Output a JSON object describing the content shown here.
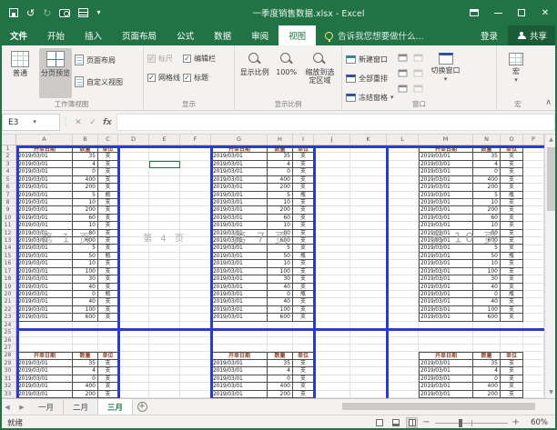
{
  "window": {
    "title": "一季度销售数据.xlsx - Excel",
    "qat_icons": [
      "save",
      "undo",
      "redo",
      "camera",
      "table",
      "more"
    ]
  },
  "menubar": {
    "file": "文件",
    "tabs": [
      "开始",
      "插入",
      "页面布局",
      "公式",
      "数据",
      "审阅",
      "视图"
    ],
    "active_tab": "视图",
    "tell_me": "告诉我您想要做什么...",
    "sign_in": "登录",
    "share": "共享"
  },
  "ribbon": {
    "workbook_views": {
      "label": "工作簿视图",
      "normal": "普通",
      "page_break_preview": "分页预览",
      "page_layout": "页面布局",
      "custom_views": "自定义视图"
    },
    "show": {
      "label": "显示",
      "ruler": "标尺",
      "formula_bar": "编辑栏",
      "gridlines": "网格线",
      "headings": "标题",
      "ruler_checked": true,
      "formula_bar_checked": true,
      "gridlines_checked": true,
      "headings_checked": true
    },
    "zoom": {
      "label": "显示比例",
      "zoom": "显示比例",
      "hundred": "100%",
      "to_selection": "缩放到选定区域"
    },
    "window": {
      "label": "窗口",
      "new_window": "新建窗口",
      "arrange_all": "全部重排",
      "freeze_panes": "冻结窗格",
      "switch_windows": "切换窗口"
    },
    "macros": {
      "label": "宏",
      "macros": "宏"
    }
  },
  "formula_bar": {
    "name_box": "E3"
  },
  "grid": {
    "column_letters": [
      "A",
      "B",
      "C",
      "D",
      "E",
      "F",
      "G",
      "H",
      "I",
      "J",
      "K",
      "L",
      "M",
      "N",
      "O",
      "P"
    ],
    "row_count": 33,
    "selected_cell": "E3",
    "table": {
      "headers": [
        "开单日期",
        "数量",
        "单位"
      ],
      "rows": [
        [
          "2019/03/01",
          "35",
          "支"
        ],
        [
          "2019/03/01",
          "4",
          "支"
        ],
        [
          "2019/03/01",
          "0",
          "支"
        ],
        [
          "2019/03/01",
          "400",
          "支"
        ],
        [
          "2019/03/01",
          "200",
          "支"
        ],
        [
          "2019/03/01",
          "5",
          "瓶"
        ],
        [
          "2019/03/01",
          "10",
          "支"
        ],
        [
          "2019/03/01",
          "200",
          "支"
        ],
        [
          "2019/03/01",
          "60",
          "支"
        ],
        [
          "2019/03/01",
          "10",
          "支"
        ],
        [
          "2019/03/01",
          "80",
          "支"
        ],
        [
          "2019/03/01",
          "600",
          "支"
        ],
        [
          "2019/03/01",
          "5",
          "支"
        ],
        [
          "2019/03/01",
          "50",
          "瓶"
        ],
        [
          "2019/03/01",
          "10",
          "支"
        ],
        [
          "2019/03/01",
          "100",
          "支"
        ],
        [
          "2019/03/01",
          "30",
          "支"
        ],
        [
          "2019/03/01",
          "40",
          "支"
        ],
        [
          "2019/03/01",
          "0",
          "瓶"
        ],
        [
          "2019/03/01",
          "40",
          "支"
        ],
        [
          "2019/03/01",
          "100",
          "支"
        ],
        [
          "2019/03/01",
          "600",
          "支"
        ]
      ]
    },
    "watermarks": [
      "第 1 页",
      "第 4 页",
      "第 7 页",
      "第 10 页"
    ]
  },
  "sheet_tabs": {
    "tabs": [
      "一月",
      "二月",
      "三月"
    ],
    "active": "三月"
  },
  "status_bar": {
    "ready": "就绪",
    "zoom_level": "60%"
  },
  "icons": {
    "dropdown": "▾",
    "undo": "↺",
    "redo": "↻",
    "close": "✕",
    "check": "✓",
    "left": "◀",
    "right": "▶",
    "up": "▲",
    "down": "▼",
    "plus": "+",
    "collapse": "∧",
    "sep": "⋮",
    "cancel": "✕",
    "enter": "✓",
    "fx": "fx"
  },
  "colors": {
    "accent_green": "#217346",
    "page_break_blue": "#2a3cc9",
    "table_header_text": "#8b4226",
    "watermark_gray": "#aeaeae"
  }
}
